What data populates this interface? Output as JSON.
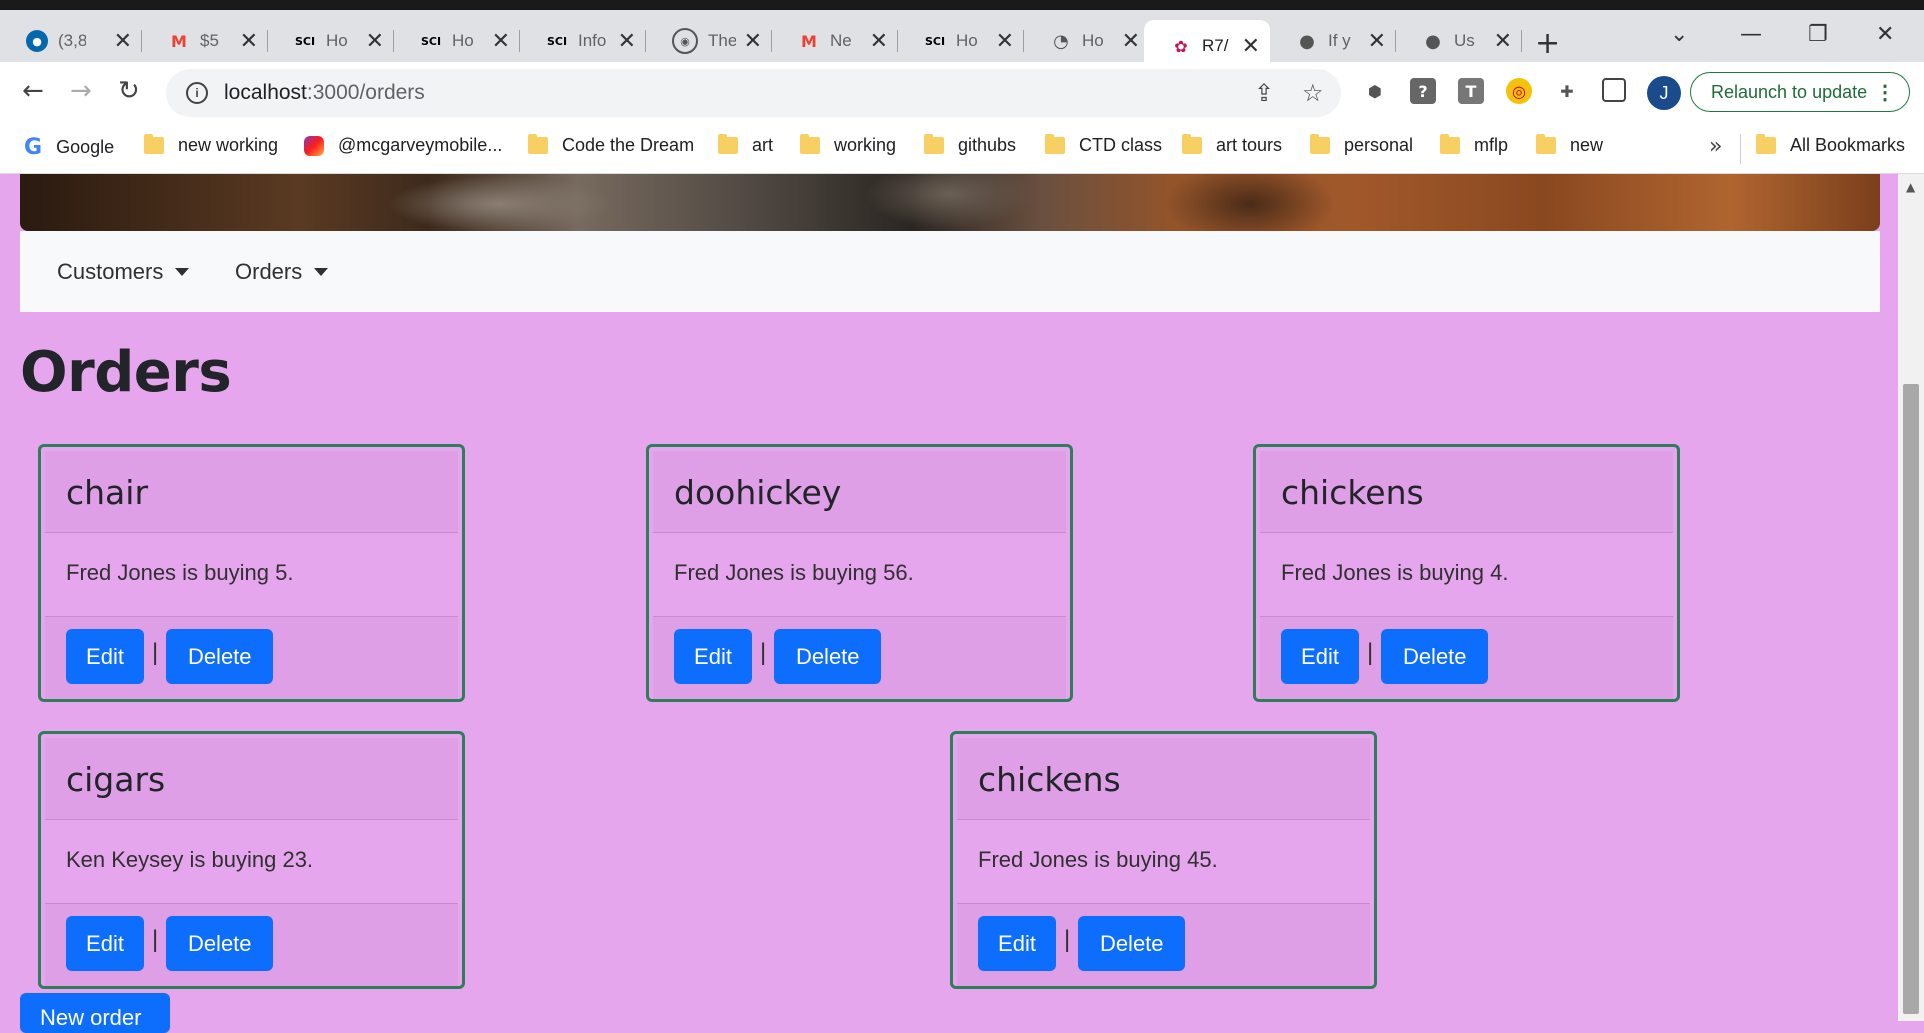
{
  "browser": {
    "tabs": [
      {
        "title": "(3,8",
        "icon": "att-icon",
        "icon_color": "#0568ae"
      },
      {
        "title": "$5",
        "icon": "gmail-icon",
        "icon_color": "#ea4335"
      },
      {
        "title": "Ho",
        "icon": "sciam-icon",
        "icon_color": "#000000"
      },
      {
        "title": "Ho",
        "icon": "sciam-icon",
        "icon_color": "#000000"
      },
      {
        "title": "Info",
        "icon": "sciam-icon",
        "icon_color": "#000000"
      },
      {
        "title": "The",
        "icon": "seal-icon",
        "icon_color": "#555555"
      },
      {
        "title": "Ne",
        "icon": "gmail-icon",
        "icon_color": "#ea4335"
      },
      {
        "title": "Ho",
        "icon": "sciam-icon",
        "icon_color": "#000000"
      },
      {
        "title": "Ho",
        "icon": "dashboard-icon",
        "icon_color": "#555555"
      },
      {
        "title": "R7/",
        "icon": "flower-icon",
        "icon_color": "#c2185b",
        "active": true
      },
      {
        "title": "If y",
        "icon": "apple-icon",
        "icon_color": "#555555"
      },
      {
        "title": "Us",
        "icon": "apple-icon",
        "icon_color": "#555555"
      }
    ],
    "address": {
      "host": "localhost",
      "path": ":3000/orders"
    },
    "avatar_initial": "J",
    "relaunch_label": "Relaunch to update",
    "bookmarks": [
      {
        "label": "Google",
        "type": "google"
      },
      {
        "label": "new working",
        "type": "folder"
      },
      {
        "label": "@mcgarveymobile...",
        "type": "instagram"
      },
      {
        "label": "Code the Dream",
        "type": "folder"
      },
      {
        "label": "art",
        "type": "folder"
      },
      {
        "label": "working",
        "type": "folder"
      },
      {
        "label": "githubs",
        "type": "folder"
      },
      {
        "label": "CTD class",
        "type": "folder"
      },
      {
        "label": "art tours",
        "type": "folder"
      },
      {
        "label": "personal",
        "type": "folder"
      },
      {
        "label": "mflp",
        "type": "folder"
      },
      {
        "label": "new",
        "type": "folder"
      }
    ],
    "all_bookmarks_label": "All Bookmarks",
    "more_label": "»"
  },
  "navbar": {
    "customers_label": "Customers",
    "orders_label": "Orders"
  },
  "page": {
    "title": "Orders",
    "new_order_label": "New order"
  },
  "orders": [
    {
      "product": "chair",
      "description": "Fred Jones is buying 5.",
      "edit_label": "Edit",
      "delete_label": "Delete",
      "separator": "|"
    },
    {
      "product": "doohickey",
      "description": "Fred Jones is buying 56.",
      "edit_label": "Edit",
      "delete_label": "Delete",
      "separator": "|"
    },
    {
      "product": "chickens",
      "description": "Fred Jones is buying 4.",
      "edit_label": "Edit",
      "delete_label": "Delete",
      "separator": "|"
    },
    {
      "product": "cigars",
      "description": "Ken Keysey is buying 23.",
      "edit_label": "Edit",
      "delete_label": "Delete",
      "separator": "|"
    },
    {
      "product": "chickens",
      "description": "Fred Jones is buying 45.",
      "edit_label": "Edit",
      "delete_label": "Delete",
      "separator": "|"
    }
  ],
  "colors": {
    "page_background": "#e6a6ee",
    "card_header": "#df9fe6",
    "card_border": "#2e7d5b",
    "button": "#0d6efd",
    "navbar": "#f8f9fa"
  }
}
